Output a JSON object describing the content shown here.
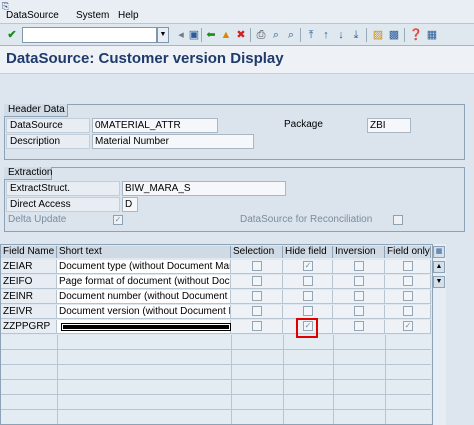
{
  "menu": {
    "datasource": "DataSource",
    "system": "System",
    "help": "Help"
  },
  "toolbar": {
    "command_value": ""
  },
  "title": "DataSource: Customer version Display",
  "header": {
    "caption": "Header Data",
    "datasource_label": "DataSource",
    "datasource_value": "0MATERIAL_ATTR",
    "package_label": "Package",
    "package_value": "ZBI",
    "description_label": "Description",
    "description_value": "Material Number"
  },
  "extraction": {
    "caption": "Extraction",
    "extractstruct_label": "ExtractStruct.",
    "extractstruct_value": "BIW_MARA_S",
    "direct_access_label": "Direct Access",
    "direct_access_value": "D",
    "delta_update_label": "Delta Update",
    "delta_update_checked": true,
    "reconciliation_label": "DataSource for Reconciliation",
    "reconciliation_checked": false
  },
  "table": {
    "headers": [
      "Field Name",
      "Short text",
      "Selection",
      "Hide field",
      "Inversion",
      "Field only"
    ],
    "rows": [
      {
        "name": "ZEIAR",
        "text": "Document type (without Document Manag",
        "selection": false,
        "hide": true,
        "inversion": false,
        "field_only": false
      },
      {
        "name": "ZEIFO",
        "text": "Page format of document (without Docume",
        "selection": false,
        "hide": false,
        "inversion": false,
        "field_only": false
      },
      {
        "name": "ZEINR",
        "text": "Document number (without Document Man",
        "selection": false,
        "hide": false,
        "inversion": false,
        "field_only": false
      },
      {
        "name": "ZEIVR",
        "text": "Document version (without Document Man",
        "selection": false,
        "hide": false,
        "inversion": false,
        "field_only": false
      },
      {
        "name": "ZZPPGRP",
        "text": "",
        "selection": false,
        "hide": true,
        "inversion": false,
        "field_only": true
      }
    ]
  },
  "colors": {
    "title": "#1f3a6b",
    "highlight": "#e00000",
    "background": "#dde6ee"
  }
}
